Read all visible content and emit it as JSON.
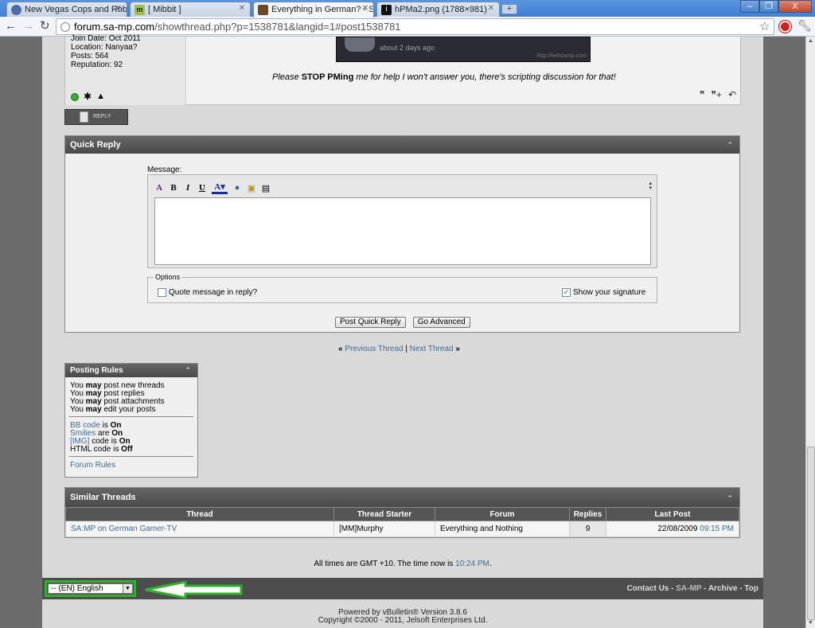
{
  "browser": {
    "tabs": [
      {
        "label": "New Vegas Cops and Robbe"
      },
      {
        "label": "[ Mibbit ]"
      },
      {
        "label": "Everything in German? - SA"
      },
      {
        "label": "hPMa2.png (1788×981)"
      }
    ],
    "new_tab": "+",
    "window_controls": {
      "minimize": "–",
      "maximize": "❐",
      "close": "X"
    },
    "url_host": "forum.sa-mp.com",
    "url_path": "/showthread.php?p=1538781&langid=1#post1538781"
  },
  "post": {
    "join_date": "Join Date: Oct 2011",
    "location": "Location: Nanyaa?",
    "posts": "Posts: 564",
    "reputation": "Reputation: 92",
    "sig_ago": "about 2 days ago",
    "sig_stamp": "http://twitstamp.com",
    "signature_pre": "Please ",
    "signature_bold": "STOP PMing",
    "signature_post": " me for help I won't answer you, there's scripting discussion for that!",
    "reply_label": "REPLY"
  },
  "quick_reply": {
    "title": "Quick Reply",
    "message_label": "Message:",
    "options_legend": "Options",
    "quote_label": "Quote message in reply?",
    "quote_checked": false,
    "signature_label": "Show your signature",
    "signature_checked": true,
    "post_button": "Post Quick Reply",
    "advanced_button": "Go Advanced"
  },
  "thread_nav": {
    "prev": "Previous Thread",
    "next": "Next Thread",
    "sep": "|",
    "left_arrows": "«",
    "right_arrows": "»"
  },
  "posting_rules": {
    "title": "Posting Rules",
    "rules": [
      {
        "pre": "You ",
        "bold": "may",
        "post": " post new threads"
      },
      {
        "pre": "You ",
        "bold": "may",
        "post": " post replies"
      },
      {
        "pre": "You ",
        "bold": "may",
        "post": " post attachments"
      },
      {
        "pre": "You ",
        "bold": "may",
        "post": " edit your posts"
      }
    ],
    "codes": [
      {
        "link": "BB code",
        "mid": " is ",
        "state": "On"
      },
      {
        "link": "Smilies",
        "mid": " are ",
        "state": "On"
      },
      {
        "link": "[IMG]",
        "mid": " code is ",
        "state": "On"
      },
      {
        "link": "",
        "mid": "HTML code is ",
        "state": "Off"
      }
    ],
    "forum_rules": "Forum Rules"
  },
  "similar_threads": {
    "title": "Similar Threads",
    "columns": [
      "Thread",
      "Thread Starter",
      "Forum",
      "Replies",
      "Last Post"
    ],
    "rows": [
      {
        "thread": "SA:MP on German Gamer-TV",
        "starter": "[MM]Murphy",
        "forum": "Everything and Nothing",
        "replies": "9",
        "date": "22/08/2009",
        "time": "09:15 PM"
      }
    ]
  },
  "footer": {
    "gmt_pre": "All times are GMT +10. The time now is ",
    "gmt_time": "10:24 PM",
    "gmt_post": ".",
    "language": "-- (EN) English",
    "contact": "Contact Us",
    "samp": "SA-MP",
    "archive": "Archive",
    "top": "Top",
    "dash": " - ",
    "powered": "Powered by vBulletin® Version 3.8.6",
    "copyright": "Copyright ©2000 - 2011, Jelsoft Enterprises Ltd."
  },
  "colors": {
    "link": "#416b94",
    "highlight": "#2fb12f"
  }
}
